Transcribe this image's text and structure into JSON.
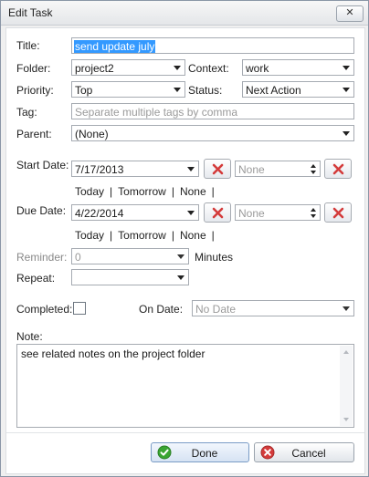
{
  "window": {
    "title": "Edit Task",
    "close_glyph": "✕"
  },
  "fields": {
    "title": {
      "label": "Title:",
      "value": "send update july"
    },
    "folder": {
      "label": "Folder:",
      "value": "project2"
    },
    "context": {
      "label": "Context:",
      "value": "work"
    },
    "priority": {
      "label": "Priority:",
      "value": "Top"
    },
    "status": {
      "label": "Status:",
      "value": "Next Action"
    },
    "tag": {
      "label": "Tag:",
      "placeholder": "Separate multiple tags by comma"
    },
    "parent": {
      "label": "Parent:",
      "value": "(None)"
    },
    "start_date": {
      "label": "Start Date:",
      "value": "7/17/2013",
      "time_placeholder": "None"
    },
    "due_date": {
      "label": "Due Date:",
      "value": "4/22/2014",
      "time_placeholder": "None"
    },
    "date_shortcuts": {
      "today": "Today",
      "tomorrow": "Tomorrow",
      "none": "None",
      "sep": "|"
    },
    "reminder": {
      "label": "Reminder:",
      "value": "0",
      "unit": "Minutes"
    },
    "repeat": {
      "label": "Repeat:",
      "value": ""
    },
    "completed": {
      "label": "Completed:",
      "checked": false
    },
    "on_date": {
      "label": "On Date:",
      "value": "No Date"
    },
    "note": {
      "label": "Note:",
      "value": "see related notes on the project folder"
    }
  },
  "buttons": {
    "done": "Done",
    "cancel": "Cancel"
  },
  "colors": {
    "selection": "#3399ff",
    "done_icon": "#3aa533",
    "cancel_icon": "#d43b3b",
    "clear_icon": "#d43b3b"
  }
}
